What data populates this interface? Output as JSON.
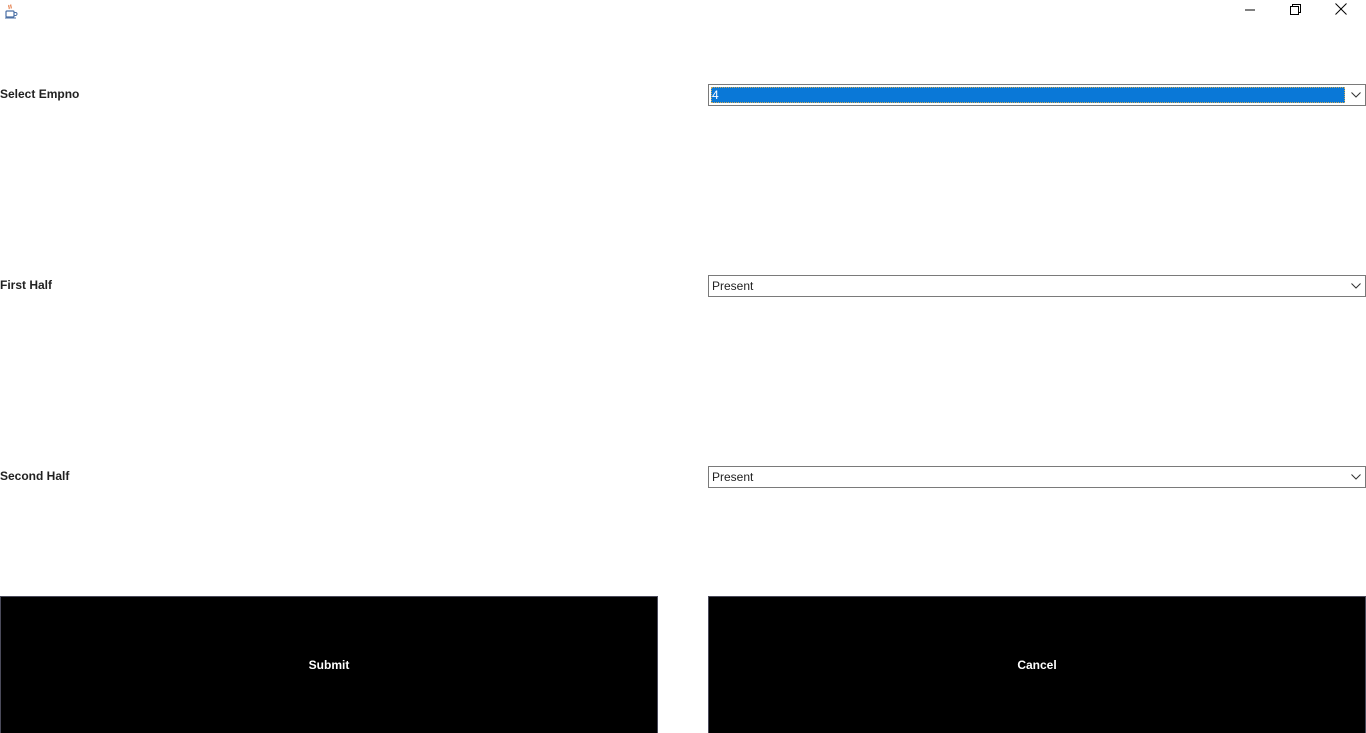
{
  "window": {
    "icon": "java-coffee-cup-icon",
    "controls": {
      "minimize_icon": "minimize-icon",
      "maximize_icon": "restore-icon",
      "close_icon": "close-icon"
    }
  },
  "form": {
    "empno_label": "Select Empno",
    "empno_value": "4",
    "first_half_label": "First Half",
    "first_half_value": "Present",
    "second_half_label": "Second Half",
    "second_half_value": "Present"
  },
  "actions": {
    "submit_label": "Submit",
    "cancel_label": "Cancel"
  },
  "colors": {
    "selection": "#0a78d7",
    "button_bg": "#000000",
    "button_text": "#ffffff"
  }
}
